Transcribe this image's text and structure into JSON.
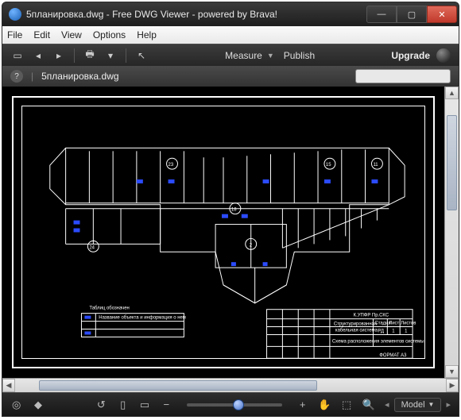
{
  "titlebar": {
    "title": "5планировка.dwg - Free DWG Viewer - powered by Brava!"
  },
  "menu": {
    "file": "File",
    "edit": "Edit",
    "view": "View",
    "options": "Options",
    "help": "Help"
  },
  "toolbar1": {
    "measure": "Measure",
    "publish": "Publish",
    "upgrade": "Upgrade"
  },
  "toolbar2": {
    "filename": "5планировка.dwg",
    "search_placeholder": ""
  },
  "drawing": {
    "nodes": [
      "23",
      "15",
      "11",
      "18",
      "24",
      "2"
    ],
    "legend_title": "Таблиц обозначен",
    "legend_row": "Название объекта и информация о нем",
    "titleblock": {
      "project": "К.УПФР Пр.СКС",
      "line1": "Структурированная",
      "line2": "кабельная система",
      "line3": "Схема расположения элементов системы",
      "format": "ФОРМАТ  A3",
      "hdr_stage": "Стадия",
      "hdr_sheet": "Лист",
      "hdr_sheets": "Листов",
      "stage": "РД",
      "sheet": "1",
      "sheets": "1"
    }
  },
  "statusbar": {
    "model_label": "Model"
  }
}
